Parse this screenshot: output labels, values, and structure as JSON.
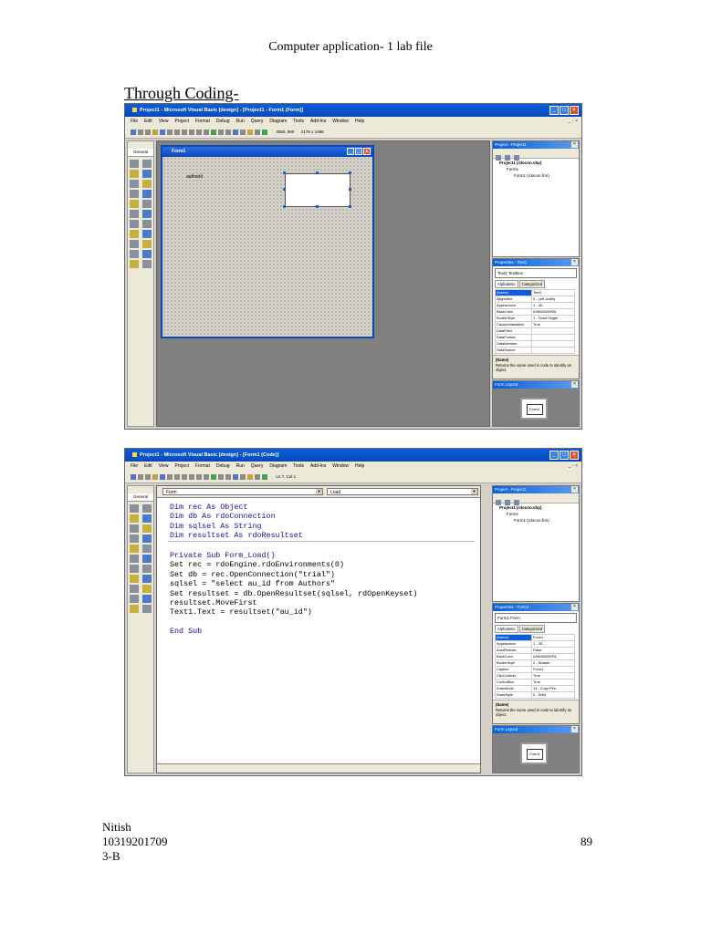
{
  "page": {
    "header": "Computer application- 1 lab file",
    "section_title": "Through Coding-",
    "footer": {
      "name": "Nitish",
      "roll": "10319201709",
      "section": "3-B",
      "page_number": "89"
    }
  },
  "menu": [
    "File",
    "Edit",
    "View",
    "Project",
    "Format",
    "Debug",
    "Run",
    "Query",
    "Diagram",
    "Tools",
    "Add-Ins",
    "Window",
    "Help"
  ],
  "shot1": {
    "title": "Project1 - Microsoft Visual Basic [design] - [Project1 - Form1 (Form)]",
    "toolbar_position": "4080, 960",
    "toolbar_size": "2175 x 1095",
    "toolbox_caption": "General",
    "form_title": "Form1",
    "label_text": "authorid",
    "project_panel_title": "Project - Project1",
    "tree": {
      "project": "Project1 (rdocon.vbp)",
      "folder": "Forms",
      "item": "Form1 (rdocon.frm)"
    },
    "properties_title": "Properties - Text1",
    "object_selector": "Text1 TextBox",
    "tabs": [
      "Alphabetic",
      "Categorized"
    ],
    "props": [
      [
        "(Name)",
        "Text1"
      ],
      [
        "Alignment",
        "0 - Left Justify"
      ],
      [
        "Appearance",
        "1 - 3D"
      ],
      [
        "BackColor",
        "&H80000005&"
      ],
      [
        "BorderStyle",
        "1 - Fixed Single"
      ],
      [
        "CausesValidation",
        "True"
      ],
      [
        "DataField",
        ""
      ],
      [
        "DataFormat",
        ""
      ],
      [
        "DataMember",
        ""
      ],
      [
        "DataSource",
        ""
      ]
    ],
    "desc_title": "(Name)",
    "desc_text": "Returns the name used in code to identify an object.",
    "layout_title": "Form Layout",
    "layout_form": "Form1"
  },
  "shot2": {
    "title": "Project1 - Microsoft Visual Basic [design] - [Form1 (Code)]",
    "toolbar_pos": "Ln 7, Col 1",
    "toolbox_caption": "General",
    "object_combo": "Form",
    "proc_combo": "Load",
    "code_decl": [
      "Dim rec As Object",
      "Dim db As rdoConnection",
      "Dim sqlsel As String",
      "Dim resultset As rdoResultset"
    ],
    "code_proc": [
      "Private Sub Form_Load()",
      "Set rec = rdoEngine.rdoEnvironments(0)",
      "Set db = rec.OpenConnection(\"trial\")",
      "sqlsel = \"select au_id from Authors\"",
      "Set resultset = db.OpenResultset(sqlsel, rdOpenKeyset)",
      "resultset.MoveFirst",
      "Text1.Text = resultset(\"au_id\")",
      "",
      "End Sub"
    ],
    "project_panel_title": "Project - Project1",
    "tree": {
      "project": "Project1 (rdocon.vbp)",
      "folder": "Forms",
      "item": "Form1 (rdocon.frm)"
    },
    "properties_title": "Properties - Form1",
    "object_selector": "Form1 Form",
    "tabs": [
      "Alphabetic",
      "Categorized"
    ],
    "props": [
      [
        "(Name)",
        "Form1"
      ],
      [
        "Appearance",
        "1 - 3D"
      ],
      [
        "AutoRedraw",
        "False"
      ],
      [
        "BackColor",
        "&H8000000F&"
      ],
      [
        "BorderStyle",
        "2 - Sizable"
      ],
      [
        "Caption",
        "Form1"
      ],
      [
        "ClipControls",
        "True"
      ],
      [
        "ControlBox",
        "True"
      ],
      [
        "DrawMode",
        "13 - Copy Pen"
      ],
      [
        "DrawStyle",
        "0 - Solid"
      ]
    ],
    "desc_title": "(Name)",
    "desc_text": "Returns the name used in code to identify an object.",
    "layout_title": "Form Layout",
    "layout_form": "Form1"
  }
}
